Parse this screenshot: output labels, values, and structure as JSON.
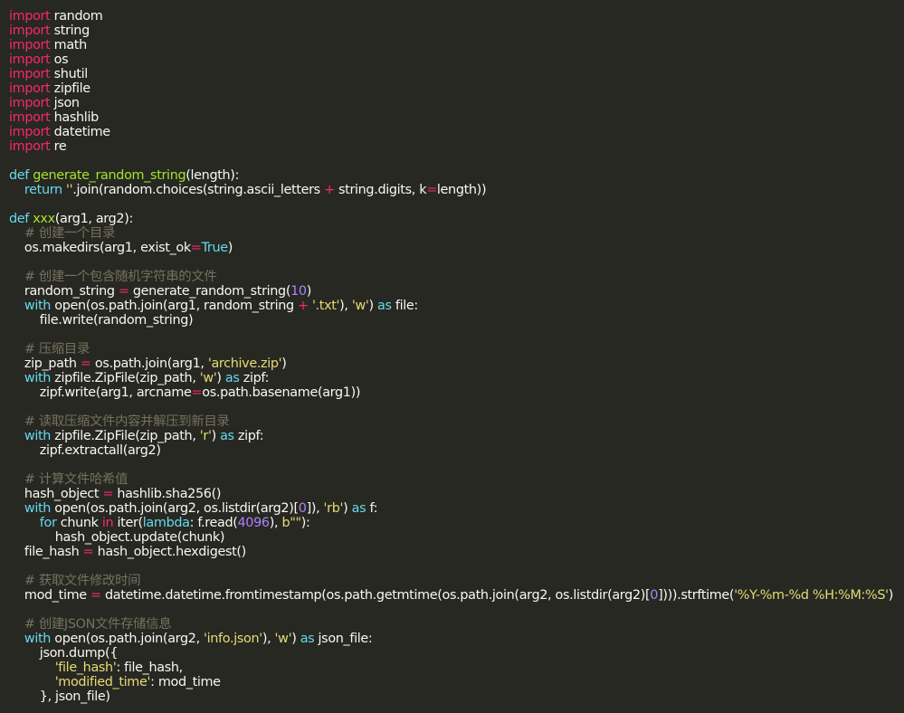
{
  "editor": {
    "theme_colors": {
      "background": "#272822",
      "foreground": "#f8f8f2",
      "keyword": "#f92672",
      "definition": "#66d9ef",
      "function_name": "#a6e22e",
      "string": "#e6db74",
      "number": "#ae81ff",
      "comment": "#75715e"
    },
    "lines": [
      [
        [
          "kw",
          "import"
        ],
        [
          "plain",
          " random"
        ]
      ],
      [
        [
          "kw",
          "import"
        ],
        [
          "plain",
          " string"
        ]
      ],
      [
        [
          "kw",
          "import"
        ],
        [
          "plain",
          " math"
        ]
      ],
      [
        [
          "kw",
          "import"
        ],
        [
          "plain",
          " os"
        ]
      ],
      [
        [
          "kw",
          "import"
        ],
        [
          "plain",
          " shutil"
        ]
      ],
      [
        [
          "kw",
          "import"
        ],
        [
          "plain",
          " zipfile"
        ]
      ],
      [
        [
          "kw",
          "import"
        ],
        [
          "plain",
          " json"
        ]
      ],
      [
        [
          "kw",
          "import"
        ],
        [
          "plain",
          " hashlib"
        ]
      ],
      [
        [
          "kw",
          "import"
        ],
        [
          "plain",
          " datetime"
        ]
      ],
      [
        [
          "kw",
          "import"
        ],
        [
          "plain",
          " re"
        ]
      ],
      [],
      [
        [
          "def",
          "def"
        ],
        [
          "plain",
          " "
        ],
        [
          "fn",
          "generate_random_string"
        ],
        [
          "plain",
          "(length):"
        ]
      ],
      [
        [
          "plain",
          "    "
        ],
        [
          "def",
          "return"
        ],
        [
          "plain",
          " "
        ],
        [
          "str",
          "''"
        ],
        [
          "plain",
          ".join(random.choices(string.ascii_letters "
        ],
        [
          "op",
          "+"
        ],
        [
          "plain",
          " string.digits, k"
        ],
        [
          "op",
          "="
        ],
        [
          "plain",
          "length))"
        ]
      ],
      [],
      [
        [
          "def",
          "def"
        ],
        [
          "plain",
          " "
        ],
        [
          "fn",
          "xxx"
        ],
        [
          "plain",
          "(arg1, arg2):"
        ]
      ],
      [
        [
          "plain",
          "    "
        ],
        [
          "cm",
          "# 创建一个目录"
        ]
      ],
      [
        [
          "plain",
          "    os.makedirs(arg1, exist_ok"
        ],
        [
          "op",
          "="
        ],
        [
          "def",
          "True"
        ],
        [
          "plain",
          ")"
        ]
      ],
      [],
      [
        [
          "plain",
          "    "
        ],
        [
          "cm",
          "# 创建一个包含随机字符串的文件"
        ]
      ],
      [
        [
          "plain",
          "    random_string "
        ],
        [
          "op",
          "="
        ],
        [
          "plain",
          " generate_random_string("
        ],
        [
          "num",
          "10"
        ],
        [
          "plain",
          ")"
        ]
      ],
      [
        [
          "plain",
          "    "
        ],
        [
          "def",
          "with"
        ],
        [
          "plain",
          " open(os.path.join(arg1, random_string "
        ],
        [
          "op",
          "+"
        ],
        [
          "plain",
          " "
        ],
        [
          "str",
          "'.txt'"
        ],
        [
          "plain",
          "), "
        ],
        [
          "str",
          "'w'"
        ],
        [
          "plain",
          ") "
        ],
        [
          "def",
          "as"
        ],
        [
          "plain",
          " file:"
        ]
      ],
      [
        [
          "plain",
          "        file.write(random_string)"
        ]
      ],
      [],
      [
        [
          "plain",
          "    "
        ],
        [
          "cm",
          "# 压缩目录"
        ]
      ],
      [
        [
          "plain",
          "    zip_path "
        ],
        [
          "op",
          "="
        ],
        [
          "plain",
          " os.path.join(arg1, "
        ],
        [
          "str",
          "'archive.zip'"
        ],
        [
          "plain",
          ")"
        ]
      ],
      [
        [
          "plain",
          "    "
        ],
        [
          "def",
          "with"
        ],
        [
          "plain",
          " zipfile.ZipFile(zip_path, "
        ],
        [
          "str",
          "'w'"
        ],
        [
          "plain",
          ") "
        ],
        [
          "def",
          "as"
        ],
        [
          "plain",
          " zipf:"
        ]
      ],
      [
        [
          "plain",
          "        zipf.write(arg1, arcname"
        ],
        [
          "op",
          "="
        ],
        [
          "plain",
          "os.path.basename(arg1))"
        ]
      ],
      [],
      [
        [
          "plain",
          "    "
        ],
        [
          "cm",
          "# 读取压缩文件内容并解压到新目录"
        ]
      ],
      [
        [
          "plain",
          "    "
        ],
        [
          "def",
          "with"
        ],
        [
          "plain",
          " zipfile.ZipFile(zip_path, "
        ],
        [
          "str",
          "'r'"
        ],
        [
          "plain",
          ") "
        ],
        [
          "def",
          "as"
        ],
        [
          "plain",
          " zipf:"
        ]
      ],
      [
        [
          "plain",
          "        zipf.extractall(arg2)"
        ]
      ],
      [],
      [
        [
          "plain",
          "    "
        ],
        [
          "cm",
          "# 计算文件哈希值"
        ]
      ],
      [
        [
          "plain",
          "    hash_object "
        ],
        [
          "op",
          "="
        ],
        [
          "plain",
          " hashlib.sha256()"
        ]
      ],
      [
        [
          "plain",
          "    "
        ],
        [
          "def",
          "with"
        ],
        [
          "plain",
          " open(os.path.join(arg2, os.listdir(arg2)["
        ],
        [
          "num",
          "0"
        ],
        [
          "plain",
          "]), "
        ],
        [
          "str",
          "'rb'"
        ],
        [
          "plain",
          ") "
        ],
        [
          "def",
          "as"
        ],
        [
          "plain",
          " f:"
        ]
      ],
      [
        [
          "plain",
          "        "
        ],
        [
          "def",
          "for"
        ],
        [
          "plain",
          " chunk "
        ],
        [
          "kw",
          "in"
        ],
        [
          "plain",
          " iter("
        ],
        [
          "def",
          "lambda"
        ],
        [
          "plain",
          ": f.read("
        ],
        [
          "num",
          "4096"
        ],
        [
          "plain",
          "), "
        ],
        [
          "str",
          "b\"\""
        ],
        [
          "plain",
          "):"
        ]
      ],
      [
        [
          "plain",
          "            hash_object.update(chunk)"
        ]
      ],
      [
        [
          "plain",
          "    file_hash "
        ],
        [
          "op",
          "="
        ],
        [
          "plain",
          " hash_object.hexdigest()"
        ]
      ],
      [],
      [
        [
          "plain",
          "    "
        ],
        [
          "cm",
          "# 获取文件修改时间"
        ]
      ],
      [
        [
          "plain",
          "    mod_time "
        ],
        [
          "op",
          "="
        ],
        [
          "plain",
          " datetime.datetime.fromtimestamp(os.path.getmtime(os.path.join(arg2, os.listdir(arg2)["
        ],
        [
          "num",
          "0"
        ],
        [
          "plain",
          "]))).strftime("
        ],
        [
          "str",
          "'%Y-%m-%d %H:%M:%S'"
        ],
        [
          "plain",
          ")"
        ]
      ],
      [],
      [
        [
          "plain",
          "    "
        ],
        [
          "cm",
          "# 创建JSON文件存储信息"
        ]
      ],
      [
        [
          "plain",
          "    "
        ],
        [
          "def",
          "with"
        ],
        [
          "plain",
          " open(os.path.join(arg2, "
        ],
        [
          "str",
          "'info.json'"
        ],
        [
          "plain",
          "), "
        ],
        [
          "str",
          "'w'"
        ],
        [
          "plain",
          ") "
        ],
        [
          "def",
          "as"
        ],
        [
          "plain",
          " json_file:"
        ]
      ],
      [
        [
          "plain",
          "        json.dump({"
        ]
      ],
      [
        [
          "plain",
          "            "
        ],
        [
          "str",
          "'file_hash'"
        ],
        [
          "plain",
          ": file_hash,"
        ]
      ],
      [
        [
          "plain",
          "            "
        ],
        [
          "str",
          "'modified_time'"
        ],
        [
          "plain",
          ": mod_time"
        ]
      ],
      [
        [
          "plain",
          "        }, json_file)"
        ]
      ]
    ]
  }
}
